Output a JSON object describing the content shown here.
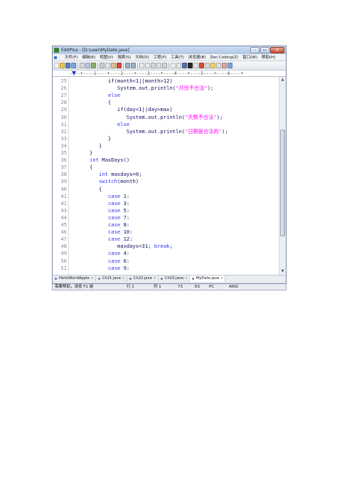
{
  "window": {
    "title": "EditPlus - [D:\\user\\MyDate.java]",
    "controls": [
      "–",
      "▭",
      "✕"
    ]
  },
  "menu": {
    "items": [
      "文件(F)",
      "编辑(E)",
      "视图(V)",
      "搜索(S)",
      "文档(D)",
      "工程(P)",
      "工具(T)",
      "浏览器(B)",
      "Zen Coding(Z)",
      "窗口(W)",
      "帮助(H)"
    ],
    "mdi_controls": "– ▭ ✕"
  },
  "ruler": {
    "text": "----+----1----+----2----+----3----+----4----+----5----+----6----+"
  },
  "editor": {
    "lines": [
      {
        "n": "25",
        "segs": [
          {
            "t": "            if(month<1||month>12)"
          }
        ]
      },
      {
        "n": "26",
        "segs": [
          {
            "t": "               System.out.println(",
            "c": ""
          },
          {
            "t": "\"月份不合法\"",
            "c": "str"
          },
          {
            "t": ");"
          }
        ]
      },
      {
        "n": "27",
        "segs": [
          {
            "t": "            "
          },
          {
            "t": "else",
            "c": "kw"
          }
        ]
      },
      {
        "n": "28",
        "segs": [
          {
            "t": "            {"
          }
        ]
      },
      {
        "n": "29",
        "segs": [
          {
            "t": "               if(day<1||day>max)"
          }
        ]
      },
      {
        "n": "30",
        "segs": [
          {
            "t": "                  System.out.println("
          },
          {
            "t": "\"天数不合法\"",
            "c": "str"
          },
          {
            "t": ");"
          }
        ]
      },
      {
        "n": "31",
        "segs": [
          {
            "t": "               "
          },
          {
            "t": "else",
            "c": "kw"
          }
        ]
      },
      {
        "n": "32",
        "segs": [
          {
            "t": "                  System.out.println("
          },
          {
            "t": "\"日期是合法的\"",
            "c": "str"
          },
          {
            "t": ");"
          }
        ]
      },
      {
        "n": "33",
        "segs": [
          {
            "t": "            }"
          }
        ]
      },
      {
        "n": "34",
        "segs": [
          {
            "t": "         }"
          }
        ]
      },
      {
        "n": "35",
        "segs": [
          {
            "t": "      }"
          }
        ]
      },
      {
        "n": "36",
        "segs": [
          {
            "t": "      "
          },
          {
            "t": "int",
            "c": "kw"
          },
          {
            "t": " MaxDays()"
          }
        ]
      },
      {
        "n": "37",
        "segs": [
          {
            "t": "      {"
          }
        ]
      },
      {
        "n": "38",
        "segs": [
          {
            "t": "         "
          },
          {
            "t": "int",
            "c": "kw"
          },
          {
            "t": " maxdays=0;"
          }
        ]
      },
      {
        "n": "39",
        "segs": [
          {
            "t": "         "
          },
          {
            "t": "switch",
            "c": "kw"
          },
          {
            "t": "(month)"
          }
        ]
      },
      {
        "n": "40",
        "segs": [
          {
            "t": "         {"
          }
        ]
      },
      {
        "n": "41",
        "segs": [
          {
            "t": "            "
          },
          {
            "t": "case",
            "c": "kw"
          },
          {
            "t": " 1:"
          }
        ]
      },
      {
        "n": "42",
        "segs": [
          {
            "t": "            "
          },
          {
            "t": "case",
            "c": "kw"
          },
          {
            "t": " 3:"
          }
        ]
      },
      {
        "n": "43",
        "segs": [
          {
            "t": "            "
          },
          {
            "t": "case",
            "c": "kw"
          },
          {
            "t": " 5:"
          }
        ]
      },
      {
        "n": "44",
        "segs": [
          {
            "t": "            "
          },
          {
            "t": "case",
            "c": "kw"
          },
          {
            "t": " 7:"
          }
        ]
      },
      {
        "n": "45",
        "segs": [
          {
            "t": "            "
          },
          {
            "t": "case",
            "c": "kw"
          },
          {
            "t": " 8:"
          }
        ]
      },
      {
        "n": "46",
        "segs": [
          {
            "t": "            "
          },
          {
            "t": "case",
            "c": "kw"
          },
          {
            "t": " 10:"
          }
        ]
      },
      {
        "n": "47",
        "segs": [
          {
            "t": "            "
          },
          {
            "t": "case",
            "c": "kw"
          },
          {
            "t": " 12:"
          }
        ]
      },
      {
        "n": "48",
        "segs": [
          {
            "t": "               maxdays=31; "
          },
          {
            "t": "break",
            "c": "kw"
          },
          {
            "t": ";"
          }
        ]
      },
      {
        "n": "49",
        "segs": [
          {
            "t": "            "
          },
          {
            "t": "case",
            "c": "kw"
          },
          {
            "t": " 4:"
          }
        ]
      },
      {
        "n": "50",
        "segs": [
          {
            "t": "            "
          },
          {
            "t": "case",
            "c": "kw"
          },
          {
            "t": " 6:"
          }
        ]
      },
      {
        "n": "51",
        "segs": [
          {
            "t": "            "
          },
          {
            "t": "case",
            "c": "kw"
          },
          {
            "t": " 9:"
          }
        ]
      }
    ]
  },
  "tabs": {
    "items": [
      "HelloWorldApple",
      "Ch21.java",
      "Ch22.java",
      "Ch23.java",
      "MyDate.java"
    ],
    "active_index": 4
  },
  "status": {
    "help": "需要帮助，请按 F1 键",
    "row": "行 1",
    "col": "列 1",
    "lines": "73",
    "chars": "63",
    "eol": "PC",
    "encoding": "ANSI"
  },
  "colors": {
    "keyword": "#3030ff",
    "string": "#ff00ff",
    "identifier": "#0d0d60"
  }
}
